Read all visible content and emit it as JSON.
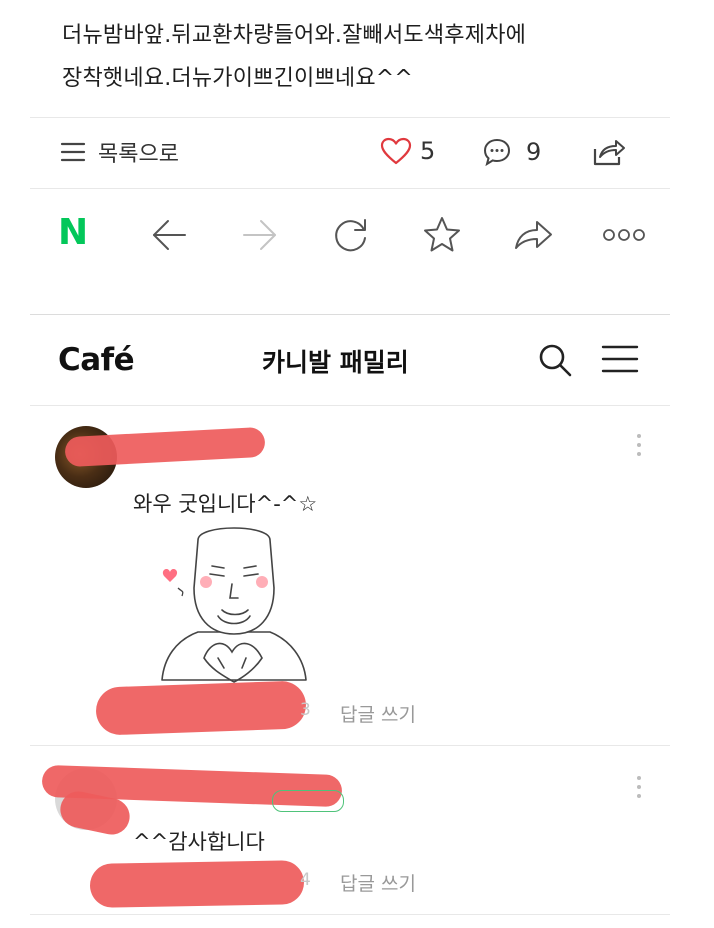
{
  "post": {
    "line1": "더뉴밤바앞.뒤교환차량들어와.잘빼서도색후제차에",
    "line2": "장착햇네요.더뉴가이쁘긴이쁘네요^^"
  },
  "actions": {
    "list_label": "목록으로",
    "like_count": "5",
    "comment_count": "9"
  },
  "browser": {
    "brand_letter": "N"
  },
  "cafe_header": {
    "logo": "Café",
    "title": "카니발 패밀리"
  },
  "comments": [
    {
      "text": "와우 굿입니다^-^☆",
      "reply_label": "답글 쓰기",
      "partial_date": "3"
    },
    {
      "text": "^^감사합니다",
      "reply_label": "답글 쓰기",
      "partial_date": "4"
    }
  ],
  "colors": {
    "naver_green": "#03c75a",
    "like_red": "#e0393e",
    "redaction": "#ee5b5b"
  }
}
